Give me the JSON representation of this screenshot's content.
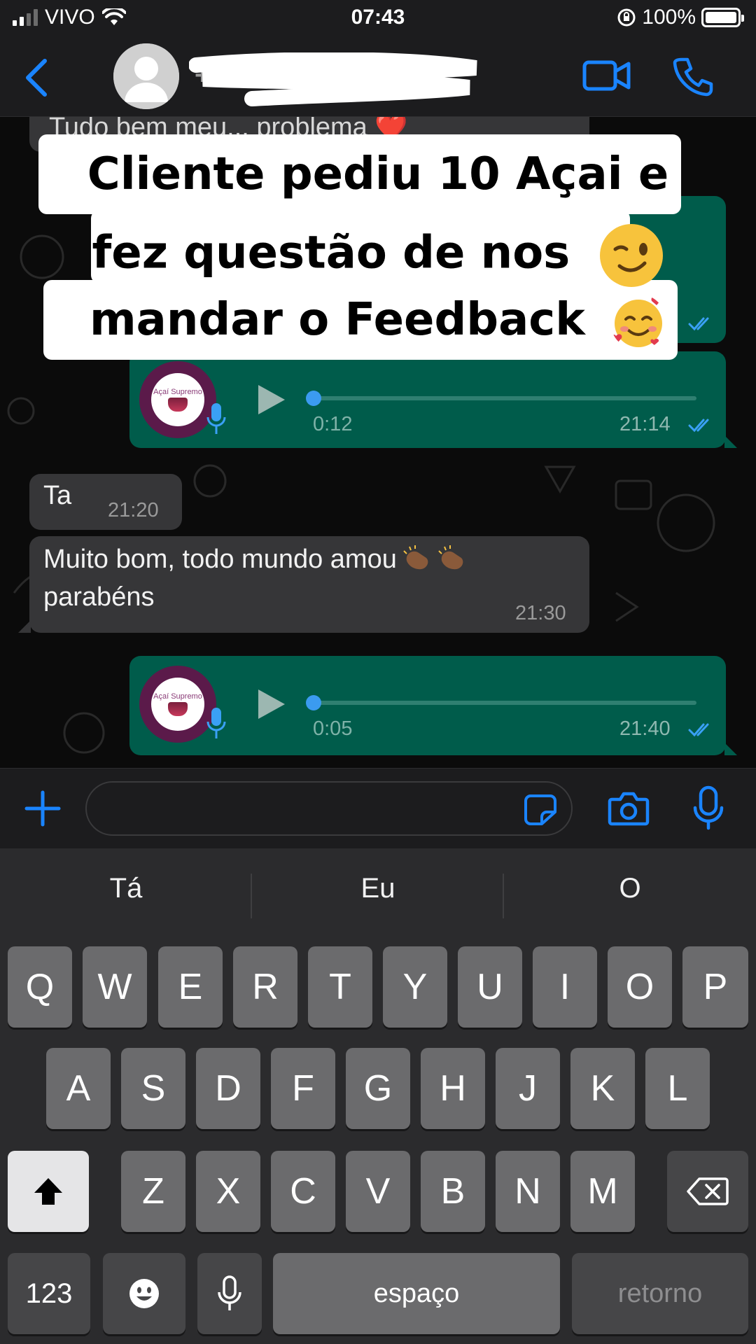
{
  "status_bar": {
    "carrier": "VIVO",
    "time": "07:43",
    "battery": "100%",
    "battery_level": 1.0
  },
  "header": {
    "contact_name": "+55 27 ·····",
    "back_icon": "chevron-left-icon",
    "video_icon": "video-camera-icon",
    "call_icon": "phone-icon",
    "accent": "#1a84ff"
  },
  "messages": [
    {
      "type": "text",
      "direction": "in",
      "text": "Tudo bem meu... problema ❤️",
      "time": ""
    },
    {
      "type": "voice",
      "direction": "out",
      "duration": "",
      "time": "",
      "read": true
    },
    {
      "type": "voice",
      "direction": "out",
      "duration": "0:12",
      "time": "21:14",
      "read": true,
      "brand": "Açaí Supremo"
    },
    {
      "type": "text",
      "direction": "in",
      "text": "Ta",
      "time": "21:20"
    },
    {
      "type": "text",
      "direction": "in",
      "text_line1": "Muito bom, todo mundo amou",
      "text_line2": "parabéns",
      "time": "21:30"
    },
    {
      "type": "voice",
      "direction": "out",
      "duration": "0:05",
      "time": "21:40",
      "read": true,
      "brand": "Açaí Supremo"
    }
  ],
  "caption": {
    "line1": "Cliente pediu 10 Açai e",
    "line2": "fez questão de nos",
    "line3": "mandar o Feedback",
    "emoji1": "winking-face-emoji",
    "emoji2": "smiling-face-with-hearts-emoji"
  },
  "composer": {
    "placeholder": "",
    "plus_icon": "plus-icon",
    "sticker_icon": "sticker-icon",
    "camera_icon": "camera-icon",
    "mic_icon": "microphone-icon"
  },
  "keyboard": {
    "suggestions": [
      "Tá",
      "Eu",
      "O"
    ],
    "row1": [
      "Q",
      "W",
      "E",
      "R",
      "T",
      "Y",
      "U",
      "I",
      "O",
      "P"
    ],
    "row2": [
      "A",
      "S",
      "D",
      "F",
      "G",
      "H",
      "J",
      "K",
      "L"
    ],
    "row3": [
      "Z",
      "X",
      "C",
      "V",
      "B",
      "N",
      "M"
    ],
    "numbers_label": "123",
    "space_label": "espaço",
    "return_label": "retorno",
    "emoji_icon": "emoji-icon",
    "dictation_icon": "microphone-icon",
    "shift_icon": "shift-icon",
    "delete_icon": "backspace-icon"
  }
}
